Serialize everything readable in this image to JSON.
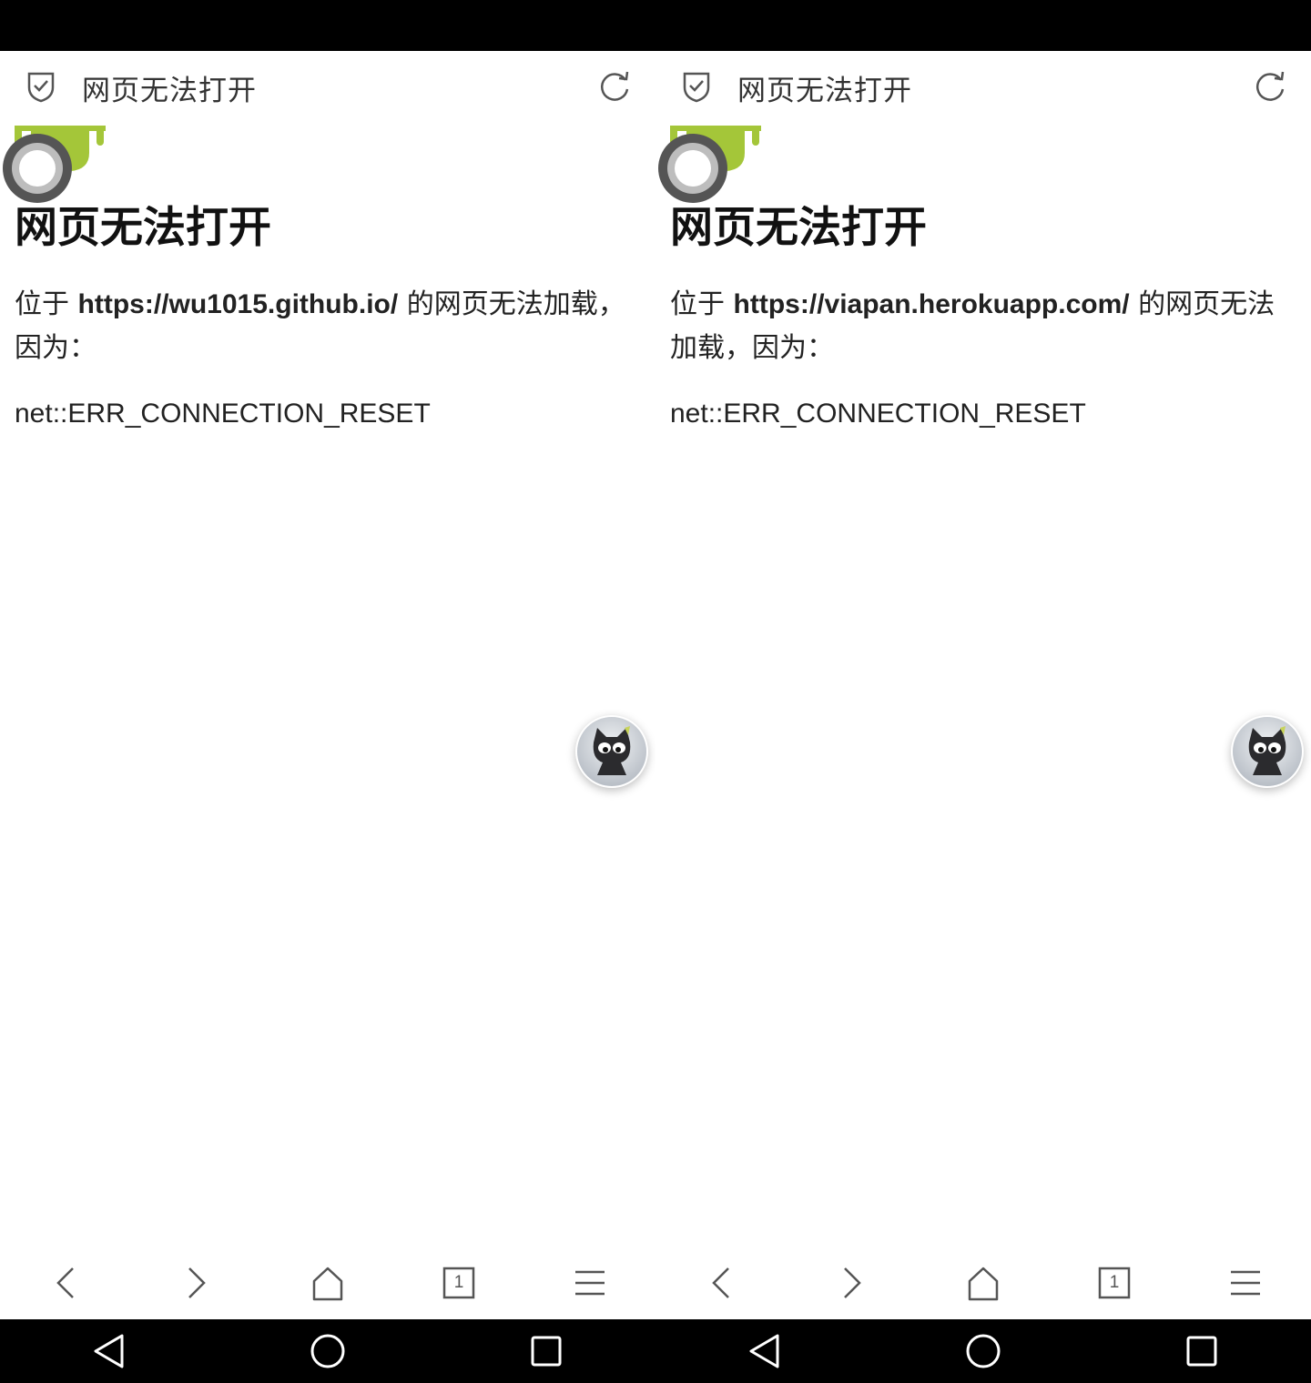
{
  "panels": [
    {
      "tab_title": "网页无法打开",
      "error_title": "网页无法打开",
      "desc_prefix": "位于 ",
      "desc_url": "https://wu1015.github.io/",
      "desc_suffix": " 的网页无法加载，因为：",
      "error_code": "net::ERR_CONNECTION_RESET",
      "tab_count": "1"
    },
    {
      "tab_title": "网页无法打开",
      "error_title": "网页无法打开",
      "desc_prefix": "位于 ",
      "desc_url": "https://viapan.herokuapp.com/",
      "desc_suffix": " 的网页无法加载，因为：",
      "error_code": "net::ERR_CONNECTION_RESET",
      "tab_count": "1"
    }
  ],
  "icons": {
    "shield": "shield-check-icon",
    "refresh": "refresh-icon",
    "back": "chevron-left-icon",
    "forward": "chevron-right-icon",
    "home": "home-icon",
    "tabs": "tabs-icon",
    "menu": "menu-icon",
    "nav_back": "nav-back-icon",
    "nav_home": "nav-home-icon",
    "nav_recents": "nav-recents-icon"
  },
  "colors": {
    "android_green": "#a4c639",
    "icon_gray": "#555555",
    "system_bar": "#000000"
  }
}
